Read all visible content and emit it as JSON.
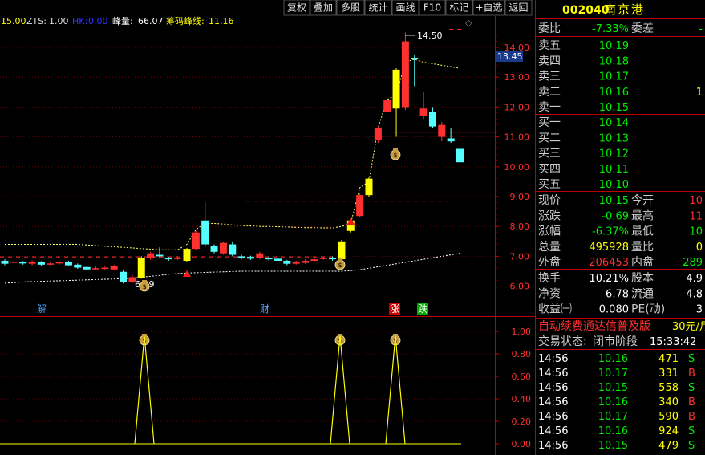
{
  "toolbar": {
    "buttons": [
      "复权",
      "叠加",
      "多股",
      "统计",
      "画线",
      "F10",
      "标记",
      "+自选",
      "返回"
    ]
  },
  "indicator_bar": {
    "value_a": "15.00",
    "zts_label": "ZTS:",
    "zts_value": "1.00",
    "hk_label": "HK:",
    "hk_value": "0.00",
    "peak_label": "峰量:",
    "peak_value": "66.07",
    "chip_label": "筹码峰线:",
    "chip_value": "11.16"
  },
  "stock": {
    "code": "002040",
    "name": "南京港"
  },
  "main_axis": {
    "ticks": [
      "14.00",
      "13.00",
      "12.00",
      "11.00",
      "10.00",
      "9.00",
      "8.00",
      "7.00",
      "6.00"
    ],
    "current_price_tag": "13.45",
    "high_annotation": "14.50",
    "low_annotation": "6.09"
  },
  "sub_axis": {
    "ticks": [
      "1.00",
      "0.80",
      "0.60",
      "0.40",
      "0.20",
      "0.00"
    ]
  },
  "event_markers": [
    "解",
    "财",
    "涨",
    "跌"
  ],
  "commission": {
    "label": "委比",
    "ratio": "-7.33%",
    "diff_label": "委差",
    "diff": "-"
  },
  "asks": [
    {
      "label": "卖五",
      "price": "10.19",
      "vol": ""
    },
    {
      "label": "卖四",
      "price": "10.18",
      "vol": ""
    },
    {
      "label": "卖三",
      "price": "10.17",
      "vol": ""
    },
    {
      "label": "卖二",
      "price": "10.16",
      "vol": "1"
    },
    {
      "label": "卖一",
      "price": "10.15",
      "vol": ""
    }
  ],
  "bids": [
    {
      "label": "买一",
      "price": "10.14",
      "vol": ""
    },
    {
      "label": "买二",
      "price": "10.13",
      "vol": ""
    },
    {
      "label": "买三",
      "price": "10.12",
      "vol": ""
    },
    {
      "label": "买四",
      "price": "10.11",
      "vol": ""
    },
    {
      "label": "买五",
      "price": "10.10",
      "vol": ""
    }
  ],
  "stats": [
    {
      "l1": "现价",
      "v1": "10.15",
      "l2": "今开",
      "v2": "10"
    },
    {
      "l1": "涨跌",
      "v1": "-0.69",
      "l2": "最高",
      "v2": "11"
    },
    {
      "l1": "涨幅",
      "v1": "-6.37%",
      "l2": "最低",
      "v2": "10"
    },
    {
      "l1": "总量",
      "v1": "495928",
      "l2": "量比",
      "v2": "0"
    },
    {
      "l1": "外盘",
      "v1": "206453",
      "l2": "内盘",
      "v2": "289"
    }
  ],
  "stats2": [
    {
      "l1": "换手",
      "v1": "10.21%",
      "l2": "股本",
      "v2": "4.9"
    },
    {
      "l1": "净资",
      "v1": "6.78",
      "l2": "流通",
      "v2": "4.8"
    },
    {
      "l1": "收益㈠",
      "v1": "0.080",
      "l2": "PE(动)",
      "v2": "3"
    }
  ],
  "promo": {
    "text": "自动续费通达信普及版",
    "price": "30元/月"
  },
  "trade_status": {
    "label": "交易状态:",
    "value": "闭市阶段",
    "time": "15:33:42"
  },
  "ticks": [
    {
      "time": "14:56",
      "price": "10.16",
      "vol": "471",
      "side": "S"
    },
    {
      "time": "14:56",
      "price": "10.17",
      "vol": "331",
      "side": "B"
    },
    {
      "time": "14:56",
      "price": "10.15",
      "vol": "558",
      "side": "S"
    },
    {
      "time": "14:56",
      "price": "10.16",
      "vol": "340",
      "side": "B"
    },
    {
      "time": "14:56",
      "price": "10.17",
      "vol": "590",
      "side": "B"
    },
    {
      "time": "14:56",
      "price": "10.16",
      "vol": "924",
      "side": "S"
    },
    {
      "time": "14:56",
      "price": "10.15",
      "vol": "479",
      "side": "S"
    }
  ],
  "chart_data": {
    "type": "candlestick",
    "ylim": [
      5.6,
      14.8
    ],
    "candles": [
      {
        "o": 6.85,
        "c": 6.75,
        "h": 6.9,
        "l": 6.7
      },
      {
        "o": 6.78,
        "c": 6.82,
        "h": 6.86,
        "l": 6.74
      },
      {
        "o": 6.8,
        "c": 6.76,
        "h": 6.84,
        "l": 6.72
      },
      {
        "o": 6.75,
        "c": 6.82,
        "h": 6.86,
        "l": 6.7
      },
      {
        "o": 6.8,
        "c": 6.72,
        "h": 6.84,
        "l": 6.68
      },
      {
        "o": 6.74,
        "c": 6.76,
        "h": 6.8,
        "l": 6.7
      },
      {
        "o": 6.76,
        "c": 6.8,
        "h": 6.84,
        "l": 6.72
      },
      {
        "o": 6.82,
        "c": 6.7,
        "h": 6.85,
        "l": 6.66
      },
      {
        "o": 6.72,
        "c": 6.62,
        "h": 6.76,
        "l": 6.58
      },
      {
        "o": 6.64,
        "c": 6.56,
        "h": 6.68,
        "l": 6.52
      },
      {
        "o": 6.58,
        "c": 6.6,
        "h": 6.65,
        "l": 6.54
      },
      {
        "o": 6.58,
        "c": 6.62,
        "h": 6.66,
        "l": 6.54
      },
      {
        "o": 6.56,
        "c": 6.68,
        "h": 6.72,
        "l": 6.52
      },
      {
        "o": 6.48,
        "c": 6.15,
        "h": 6.55,
        "l": 6.09
      },
      {
        "o": 6.14,
        "c": 6.3,
        "h": 6.4,
        "l": 6.09
      },
      {
        "o": 6.28,
        "c": 6.95,
        "h": 7.0,
        "l": 6.25,
        "hl": true
      },
      {
        "o": 6.95,
        "c": 7.1,
        "h": 7.15,
        "l": 6.88
      },
      {
        "o": 7.05,
        "c": 7.0,
        "h": 7.3,
        "l": 6.95
      },
      {
        "o": 6.95,
        "c": 6.9,
        "h": 6.98,
        "l": 6.85
      },
      {
        "o": 6.92,
        "c": 6.95,
        "h": 7.0,
        "l": 6.88
      },
      {
        "o": 6.85,
        "c": 7.25,
        "h": 7.28,
        "l": 6.82,
        "hl": true
      },
      {
        "o": 7.25,
        "c": 7.8,
        "h": 7.85,
        "l": 7.2
      },
      {
        "o": 8.2,
        "c": 7.4,
        "h": 8.8,
        "l": 7.3
      },
      {
        "o": 7.35,
        "c": 7.15,
        "h": 7.4,
        "l": 7.1
      },
      {
        "o": 7.1,
        "c": 7.45,
        "h": 7.5,
        "l": 7.05
      },
      {
        "o": 7.4,
        "c": 7.05,
        "h": 7.5,
        "l": 7.0
      },
      {
        "o": 7.0,
        "c": 6.95,
        "h": 7.05,
        "l": 6.9
      },
      {
        "o": 6.98,
        "c": 6.92,
        "h": 7.02,
        "l": 6.88
      },
      {
        "o": 6.95,
        "c": 7.1,
        "h": 7.15,
        "l": 6.9
      },
      {
        "o": 6.95,
        "c": 6.9,
        "h": 7.0,
        "l": 6.85
      },
      {
        "o": 6.92,
        "c": 6.85,
        "h": 6.95,
        "l": 6.8
      },
      {
        "o": 6.85,
        "c": 6.75,
        "h": 6.88,
        "l": 6.7
      },
      {
        "o": 6.75,
        "c": 6.8,
        "h": 6.85,
        "l": 6.72
      },
      {
        "o": 6.78,
        "c": 6.85,
        "h": 6.9,
        "l": 6.75
      },
      {
        "o": 6.85,
        "c": 6.9,
        "h": 6.95,
        "l": 6.82
      },
      {
        "o": 6.92,
        "c": 6.95,
        "h": 7.0,
        "l": 6.88
      },
      {
        "o": 6.95,
        "c": 6.9,
        "h": 7.0,
        "l": 6.85
      },
      {
        "o": 6.9,
        "c": 7.5,
        "h": 7.55,
        "l": 6.88,
        "hl": true
      },
      {
        "o": 7.85,
        "c": 8.2,
        "h": 8.25,
        "l": 7.8,
        "hl": true
      },
      {
        "o": 8.35,
        "c": 9.05,
        "h": 9.1,
        "l": 8.3
      },
      {
        "o": 9.05,
        "c": 9.6,
        "h": 9.65,
        "l": 9.0,
        "hl": true
      },
      {
        "o": 10.9,
        "c": 11.3,
        "h": 11.35,
        "l": 10.8
      },
      {
        "o": 11.85,
        "c": 12.25,
        "h": 12.3,
        "l": 11.8
      },
      {
        "o": 11.95,
        "c": 13.25,
        "h": 13.3,
        "l": 11.0,
        "hl": true
      },
      {
        "o": 12.0,
        "c": 14.2,
        "h": 14.5,
        "l": 11.9
      },
      {
        "o": 13.65,
        "c": 13.6,
        "h": 13.75,
        "l": 12.7
      },
      {
        "o": 11.7,
        "c": 11.95,
        "h": 12.5,
        "l": 11.6
      },
      {
        "o": 11.85,
        "c": 11.35,
        "h": 12.0,
        "l": 11.3
      },
      {
        "o": 11.0,
        "c": 11.4,
        "h": 11.5,
        "l": 10.85
      },
      {
        "o": 10.95,
        "c": 10.85,
        "h": 11.3,
        "l": 10.8
      },
      {
        "o": 10.6,
        "c": 10.15,
        "h": 11.0,
        "l": 10.1
      }
    ],
    "ma_upper": [
      7.4,
      7.4,
      7.4,
      7.4,
      7.4,
      7.4,
      7.4,
      7.4,
      7.4,
      7.38,
      7.36,
      7.34,
      7.32,
      7.3,
      7.28,
      7.26,
      7.24,
      7.22,
      7.22,
      7.22,
      7.4,
      7.9,
      8.1,
      8.1,
      8.08,
      8.05,
      8.03,
      8.02,
      8.0,
      8.0,
      7.99,
      7.98,
      7.97,
      7.96,
      7.96,
      7.95,
      7.95,
      8.0,
      8.1,
      9.3,
      9.5,
      11.3,
      12.25,
      12.4,
      13.5,
      13.6,
      13.5,
      13.45,
      13.4,
      13.35,
      13.3
    ],
    "ma_lower": [
      6.1,
      6.12,
      6.14,
      6.15,
      6.16,
      6.17,
      6.18,
      6.19,
      6.2,
      6.21,
      6.22,
      6.23,
      6.24,
      6.25,
      6.26,
      6.3,
      6.33,
      6.36,
      6.4,
      6.42,
      6.44,
      6.45,
      6.46,
      6.47,
      6.48,
      6.49,
      6.5,
      6.5,
      6.5,
      6.5,
      6.5,
      6.5,
      6.5,
      6.5,
      6.5,
      6.5,
      6.5,
      6.5,
      6.52,
      6.55,
      6.6,
      6.65,
      6.7,
      6.75,
      6.8,
      6.85,
      6.9,
      6.95,
      7.0,
      7.05,
      7.1
    ],
    "chip_line": 11.16,
    "dashed_level": 8.85,
    "flat_level": 6.98,
    "sub_peaks": [
      14,
      37,
      41
    ],
    "sub_ylim": [
      0,
      1.0
    ]
  }
}
